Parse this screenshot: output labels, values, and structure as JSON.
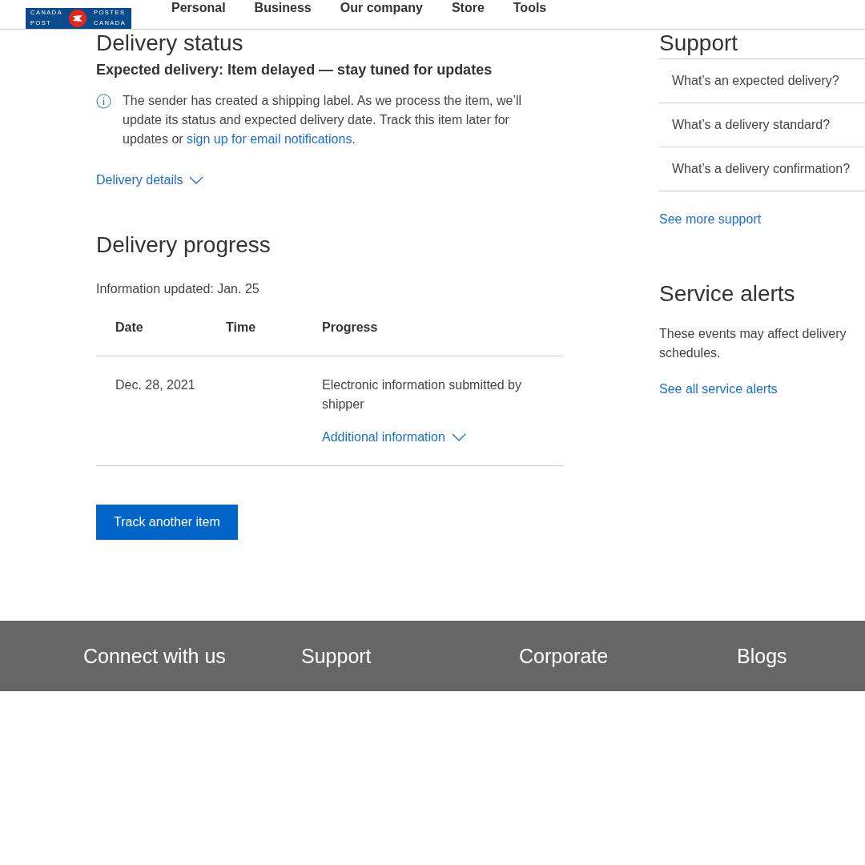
{
  "header": {
    "logo": {
      "top_left": "CANADA",
      "bottom_left": "POST",
      "top_right": "POSTES",
      "bottom_right": "CANADA"
    },
    "nav": [
      "Personal",
      "Business",
      "Our company",
      "Store",
      "Tools"
    ]
  },
  "delivery_status": {
    "title": "Delivery status",
    "expected": "Expected delivery: Item delayed — stay tuned for updates",
    "note": {
      "before": "The sender has created a shipping label. As we process the item, we’ll update its status and expected delivery date. Track this item later for updates or ",
      "link": "sign up for email notifications",
      "after": "."
    },
    "details_toggle": {
      "label": "Delivery details",
      "expanded": false
    }
  },
  "delivery_progress": {
    "title": "Delivery progress",
    "updated": "Information updated: Jan. 25",
    "columns": [
      "Date",
      "Time",
      "Progress"
    ],
    "rows": [
      {
        "date": "Dec. 28, 2021",
        "time": "",
        "progress": "Electronic information submitted by shipper",
        "more": {
          "label": "Additional information",
          "expanded": false
        }
      }
    ]
  },
  "track_button": "Track another item",
  "support": {
    "title": "Support",
    "links": [
      "What’s an expected delivery?",
      "What’s a delivery standard?",
      "What’s a delivery confirmation?"
    ],
    "more": "See more support"
  },
  "service_alerts": {
    "title": "Service alerts",
    "text": "These events may affect delivery schedules.",
    "link": "See all service alerts"
  },
  "footer": [
    "Connect with us",
    "Support",
    "Corporate",
    "Blogs"
  ]
}
